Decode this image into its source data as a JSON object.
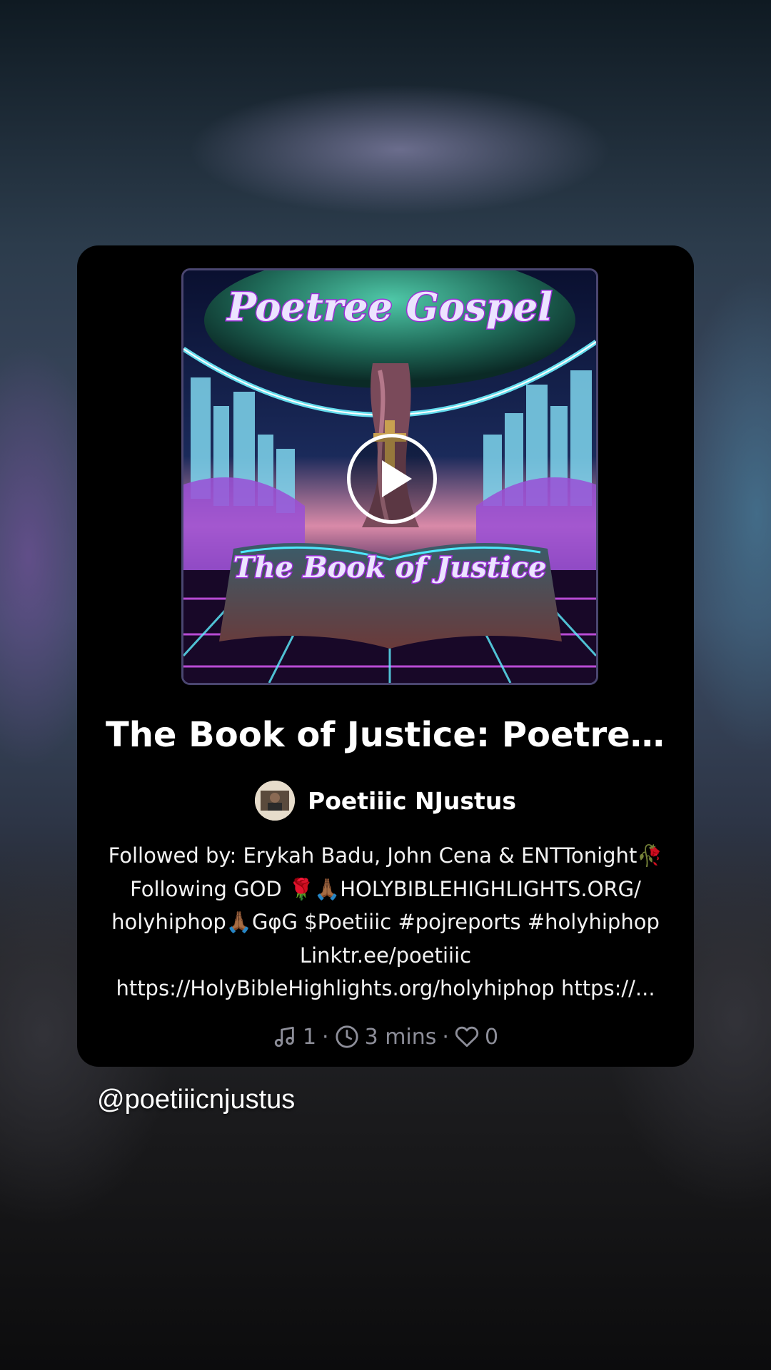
{
  "card": {
    "cover": {
      "title_text": "Poetree Gospel",
      "subtitle_text": "The Book of Justice",
      "play_icon": "play-circle-icon"
    },
    "title": "The Book of Justice: Poetree ...",
    "author": {
      "name": "Poetiiic NJustus",
      "avatar_icon": "avatar"
    },
    "description_lines": [
      "Followed by: Erykah Badu, John Cena & ENTTonight🥀",
      "Following GOD 🌹🙏🏾HOLYBIBLEHIGHLIGHTS.ORG/",
      "holyhiphop🙏🏾GφG $Poetiiic #pojreports #holyhiphop",
      "Linktr.ee/poetiiic",
      "https://HolyBibleHighlights.org/holyhiphop  https://..."
    ],
    "stats": {
      "tracks_icon": "music-note-icon",
      "tracks": "1",
      "sep1": "·",
      "duration_icon": "clock-icon",
      "duration": "3 mins",
      "sep2": "·",
      "likes_icon": "heart-icon",
      "likes": "0"
    }
  },
  "handle": "@poetiiicnjustus",
  "colors": {
    "card_bg": "#000000",
    "meta_text": "#8d8e99",
    "accent_purple": "#c77dff",
    "accent_cyan": "#4de8ff"
  }
}
